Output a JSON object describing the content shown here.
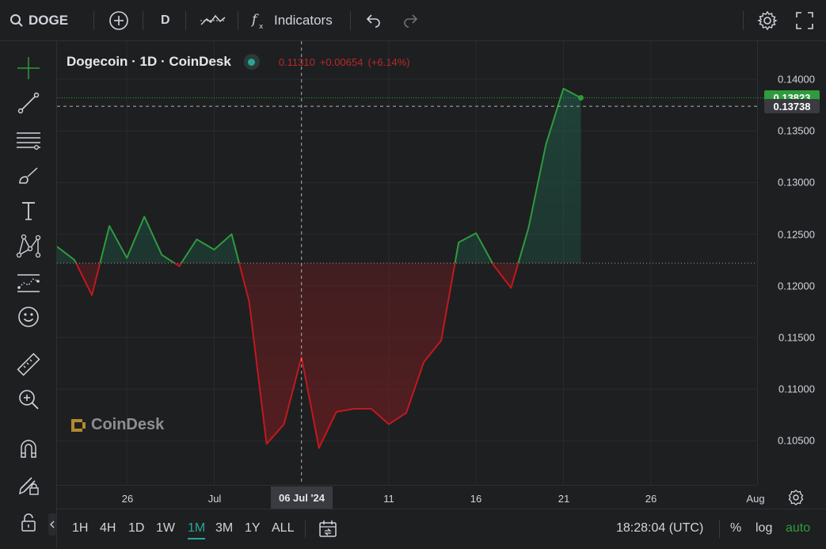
{
  "toolbar": {
    "symbol": "DOGE",
    "interval": "D",
    "indicators_label": "Indicators"
  },
  "legend": {
    "title": "Dogecoin · 1D · CoinDesk",
    "close": "0.11310",
    "change": "+0.00654",
    "change_pct": "(+6.14%)"
  },
  "watermark": "CoinDesk",
  "price_axis": {
    "labels": [
      "0.14000",
      "0.13500",
      "0.13000",
      "0.12500",
      "0.12000",
      "0.11500",
      "0.11000",
      "0.10500"
    ],
    "current_tag": "0.13823",
    "crosshair_tag": "0.13738"
  },
  "time_axis": {
    "labels": [
      "26",
      "Jul",
      "11",
      "16",
      "21",
      "26",
      "Aug"
    ],
    "crosshair_date": "06 Jul '24"
  },
  "bottom": {
    "ranges": [
      "1H",
      "4H",
      "1D",
      "1W",
      "1M",
      "3M",
      "1Y",
      "ALL"
    ],
    "active_range": "1M",
    "time": "18:28:04 (UTC)",
    "percent": "%",
    "log": "log",
    "auto": "auto"
  },
  "colors": {
    "up": "#2e9b3c",
    "down": "#c0191f",
    "accent": "#26a69a",
    "background": "#1e1f21"
  },
  "icons": [
    "search-icon",
    "plus-circle-icon",
    "line-style-icon",
    "fx-icon",
    "undo-icon",
    "redo-icon",
    "gear-icon",
    "fullscreen-icon",
    "crosshair-icon",
    "trend-line-icon",
    "horizontal-lines-icon",
    "brush-icon",
    "text-icon",
    "pattern-icon",
    "forecast-icon",
    "emoji-icon",
    "ruler-icon",
    "zoom-in-icon",
    "magnet-icon",
    "lock-draw-icon",
    "lock-icon",
    "calendar-range-icon"
  ],
  "chart_data": {
    "type": "area",
    "title": "Dogecoin · 1D · CoinDesk",
    "baseline": 0.1222,
    "ylim": [
      0.1025,
      0.1415
    ],
    "grid": true,
    "x": [
      "2024-06-22",
      "2024-06-23",
      "2024-06-24",
      "2024-06-25",
      "2024-06-26",
      "2024-06-27",
      "2024-06-28",
      "2024-06-29",
      "2024-06-30",
      "2024-07-01",
      "2024-07-02",
      "2024-07-03",
      "2024-07-04",
      "2024-07-05",
      "2024-07-06",
      "2024-07-07",
      "2024-07-08",
      "2024-07-09",
      "2024-07-10",
      "2024-07-11",
      "2024-07-12",
      "2024-07-13",
      "2024-07-14",
      "2024-07-15",
      "2024-07-16",
      "2024-07-17",
      "2024-07-18",
      "2024-07-19",
      "2024-07-20",
      "2024-07-21",
      "2024-07-22"
    ],
    "y": [
      0.1238,
      0.1225,
      0.1191,
      0.1258,
      0.1227,
      0.1267,
      0.123,
      0.1219,
      0.1245,
      0.1235,
      0.125,
      0.1185,
      0.1047,
      0.1066,
      0.1131,
      0.1043,
      0.1078,
      0.1081,
      0.1081,
      0.1066,
      0.1077,
      0.1126,
      0.1147,
      0.1242,
      0.1251,
      0.122,
      0.1198,
      0.1256,
      0.1337,
      0.1391,
      0.1382
    ]
  }
}
